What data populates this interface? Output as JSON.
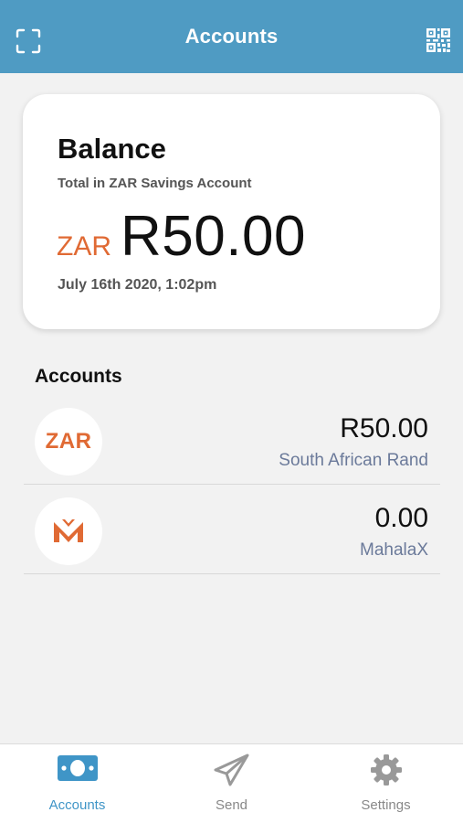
{
  "header": {
    "title": "Accounts",
    "left_icon": "scan-icon",
    "right_icon": "qr-code-icon",
    "bg_color": "#4f9bc3"
  },
  "balance_card": {
    "title": "Balance",
    "subtitle": "Total in ZAR Savings Account",
    "currency": "ZAR",
    "amount": "R50.00",
    "date": "July 16th 2020, 1:02pm"
  },
  "accounts": {
    "title": "Accounts",
    "items": [
      {
        "avatar_text": "ZAR",
        "amount": "R50.00",
        "name": "South African Rand",
        "icon": "zar-logo"
      },
      {
        "avatar_text": "",
        "amount": "0.00",
        "name": "MahalaX",
        "icon": "mahalax-logo-icon"
      }
    ]
  },
  "bottom_nav": {
    "items": [
      {
        "label": "Accounts",
        "icon": "cash-icon",
        "active": true
      },
      {
        "label": "Send",
        "icon": "paper-plane-icon",
        "active": false
      },
      {
        "label": "Settings",
        "icon": "gear-icon",
        "active": false
      }
    ]
  },
  "colors": {
    "accent": "#3f95c7",
    "brand_orange": "#e06a34",
    "secondary_text": "#6b7a9a"
  }
}
